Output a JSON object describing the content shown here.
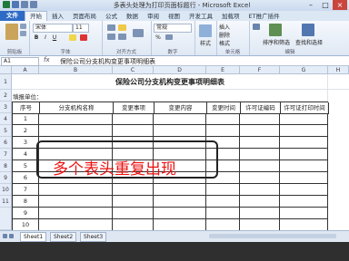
{
  "window": {
    "title": "多表头处理为打印页面标题行 - Microsoft Excel"
  },
  "tabs": [
    "文件",
    "开始",
    "插入",
    "页面布局",
    "公式",
    "数据",
    "审阅",
    "视图",
    "开发工具",
    "加载项",
    "ET推广插件"
  ],
  "ribbon": {
    "font_name": "宋体",
    "font_size": "11",
    "bold": "B",
    "italic": "I",
    "underline": "U",
    "number_format": "常规",
    "percent": "%",
    "style_label": "样式",
    "insert": "插入",
    "delete": "删除",
    "format": "格式",
    "sort_filter": "排序和筛选",
    "find_select": "查找和选择",
    "groups": {
      "clipboard": "剪贴板",
      "font": "字体",
      "alignment": "对齐方式",
      "number": "数字",
      "cells": "单元格",
      "editing": "编辑"
    }
  },
  "formula_bar": {
    "name_box": "A1",
    "fx": "fx",
    "content": "保险公司分支机构变更事项明细表"
  },
  "columns": [
    "A",
    "B",
    "C",
    "D",
    "E",
    "F",
    "G",
    "H"
  ],
  "rows": [
    "1",
    "2",
    "3",
    "4",
    "5",
    "6",
    "7",
    "8",
    "9",
    "10",
    "11"
  ],
  "sheet": {
    "title": "保险公司分支机构变更事项明细表",
    "unit_label": "填报单位：",
    "headers": [
      "序号",
      "分支机构名称",
      "变更事项",
      "变更内容",
      "变更时间",
      "许可证编码",
      "许可证打印时间"
    ],
    "serials": [
      "1",
      "2",
      "3",
      "4",
      "5",
      "6",
      "7",
      "8",
      "9",
      "10"
    ]
  },
  "overlay_text": "多个表头重复出现",
  "sheet_tabs": [
    "Sheet1",
    "Sheet2",
    "Sheet3"
  ]
}
